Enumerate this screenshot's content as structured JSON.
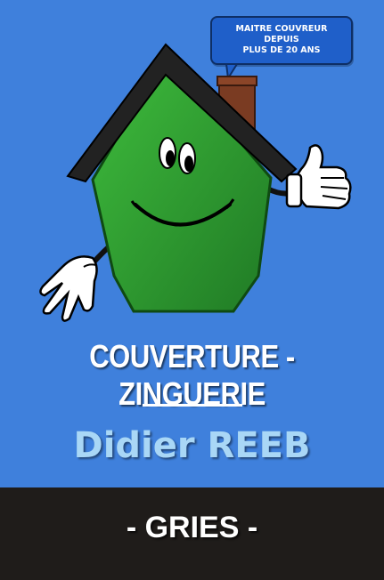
{
  "card": {
    "badge": {
      "line1": "MAITRE COUVREUR",
      "line2": "DEPUIS",
      "line3": "PLUS DE 20 ANS"
    },
    "mascot": {
      "icon": "smiling-house-mascot-icon"
    },
    "title": "COUVERTURE - ZINGUERIE",
    "name": "Didier REEB",
    "city": "- GRIES -"
  },
  "colors": {
    "background": "#3f80dc",
    "house_green": "#33a335",
    "roof": "#222222",
    "chimney": "#7a3b22",
    "name_color": "#a9d7f6",
    "footer": "#1f1c1a"
  }
}
